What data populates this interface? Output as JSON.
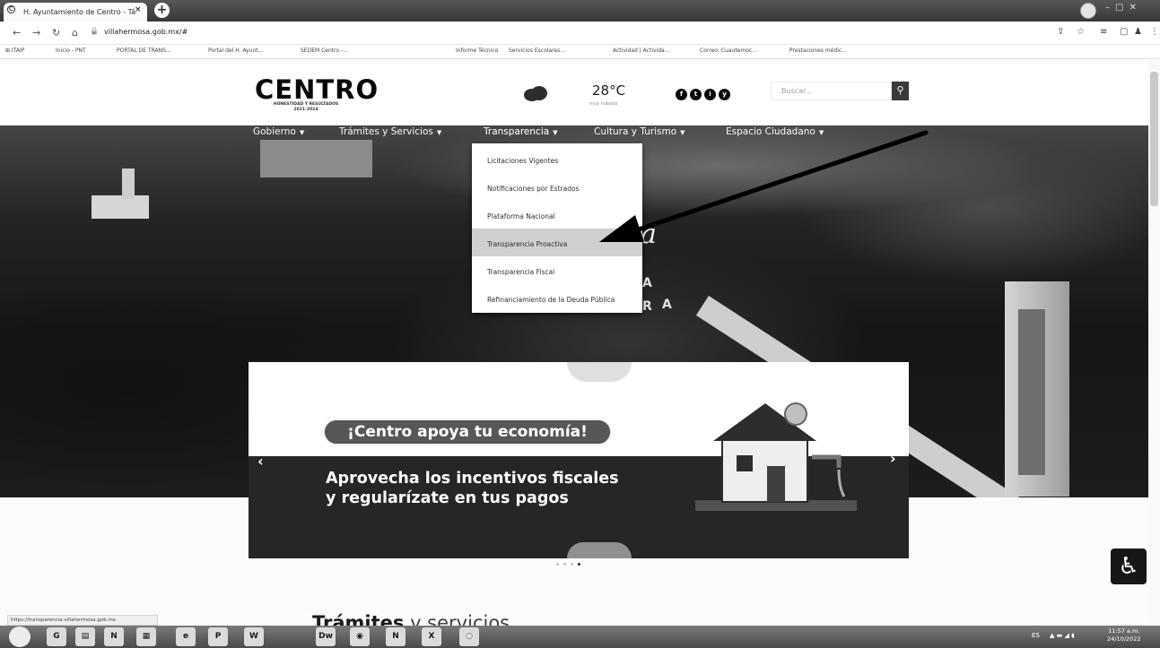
{
  "browser": {
    "tab_title": "H. Ayuntamiento de Centro - Tá",
    "tab_close": "×",
    "new_tab": "+",
    "url": "villahermosa.gob.mx/#",
    "bookmarks": [
      "Inicio - PNT",
      "PORTAL DE TRANS...",
      "Portal del H. Ayunt...",
      "SEDEM Centro -...",
      "Informe Técnico",
      "Servicios Escolares...",
      "Actividad | Activida...",
      "Correo: Cuautemoc...",
      "Prestaciones médic..."
    ],
    "status_url": "https://transparencia.villahermosa.gob.mx"
  },
  "header": {
    "logo": "CENTRO",
    "logo_sub": "HONESTIDAD Y RESULTADOS",
    "logo_years": "2021-2024",
    "temperature": "28°C",
    "weather_desc": "muy nubado",
    "search_placeholder": "Buscar...",
    "search_icon": "magnifier-icon",
    "social": [
      "f",
      "t",
      "i",
      "y"
    ]
  },
  "nav": {
    "items": [
      "Gobierno",
      "Trámites y Servicios",
      "Transparencia",
      "Cultura y Turismo",
      "Espacio Ciudadano"
    ],
    "caret": "▼"
  },
  "dropdown": {
    "items": [
      "Licitaciones Vigentes",
      "Notificaciones por Estrados",
      "Plataforma Nacional",
      "Transparencia Proactiva",
      "Transparencia Fiscal",
      "Refinanciamiento de la Deuda Pública"
    ],
    "highlighted_index": 3
  },
  "hero": {
    "script_text": "a",
    "letter_a1": "A",
    "letter_r": "R",
    "letter_a2": "A"
  },
  "slide": {
    "pill": "¡Centro apoya tu economía!",
    "headline_1": "Aprovecha los incentivos fiscales",
    "headline_2": "y regularízate en tus pagos",
    "prev": "‹",
    "next": "›",
    "dots_total": 4,
    "dots_active": 3
  },
  "section": {
    "title_bold": "Trámites",
    "title_light": " y servicios"
  },
  "a11y": {
    "icon": "♿"
  },
  "taskbar": {
    "time": "11:57 a.m.",
    "date": "24/10/2022",
    "lang": "ES"
  },
  "colors": {
    "accent": "#3e3e3e",
    "dropdown_highlight": "#c9c9c9"
  }
}
